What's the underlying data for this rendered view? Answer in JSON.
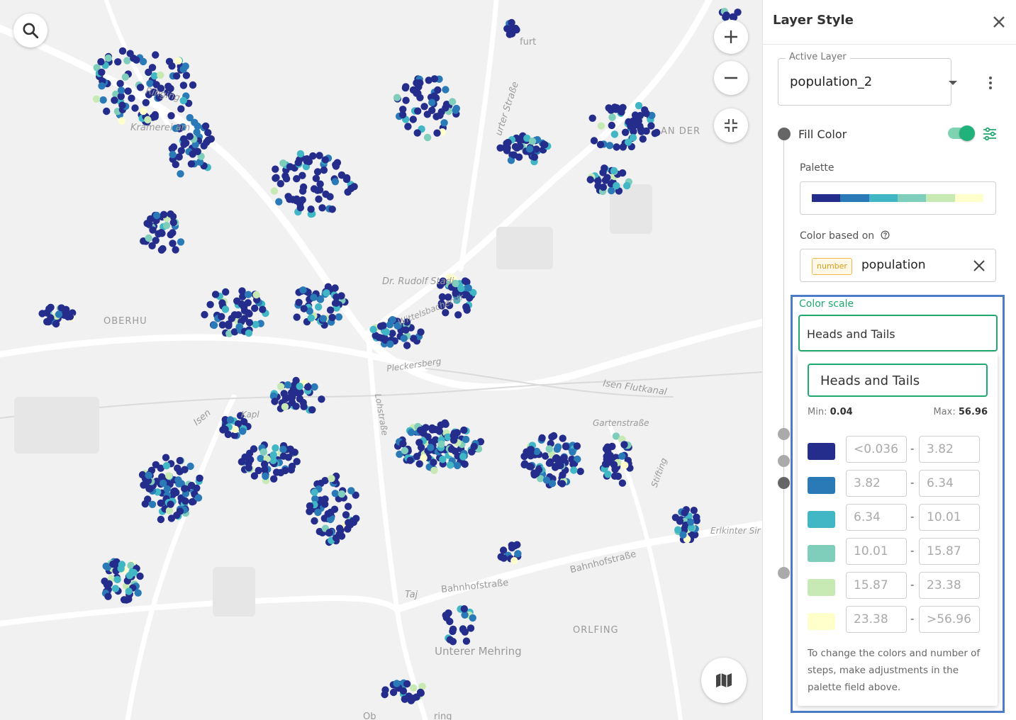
{
  "map": {
    "labels": [
      "Ringing",
      "Kramerei am",
      "OBERHU",
      "Dr. Rudolf Stadi",
      "Isen Flutkanal",
      "Isen",
      "Bahnhofstraße",
      "Bahnhofstraße",
      "Taj",
      "ORLFING",
      "Unterer Mehring",
      "AN DER",
      "furt",
      "urter Straße",
      "Gartenstraße",
      "Stifting",
      "Erlkinter Sir",
      "Wittelsbacherstr",
      "Kapl",
      "Lohstraße",
      "Pleckersberg",
      "Ob",
      "ring"
    ],
    "controls": {
      "search": "search-icon",
      "zoom_in": "plus-icon",
      "zoom_out": "minus-icon",
      "fit": "compress-icon",
      "basemap": "map-icon"
    },
    "point_colors": [
      "#252d8c",
      "#2a7ab8",
      "#41b6c4",
      "#7fcdbb",
      "#c7e9b4",
      "#ffffcc"
    ]
  },
  "panel": {
    "title": "Layer Style",
    "close_icon": "close-icon",
    "active_layer": {
      "label": "Active Layer",
      "value": "population_2"
    },
    "fill_color": {
      "label": "Fill Color",
      "enabled": true
    },
    "palette": {
      "label": "Palette",
      "colors": [
        "#252d8c",
        "#2a7ab8",
        "#41b6c4",
        "#7fcdbb",
        "#c7e9b4",
        "#ffffcc"
      ]
    },
    "color_based_on": {
      "label": "Color based on",
      "type_badge": "number",
      "value": "population"
    },
    "color_scale": {
      "label": "Color scale",
      "selected": "Heads and Tails",
      "dropdown_option": "Heads and Tails",
      "min_label": "Min:",
      "min_value": "0.04",
      "max_label": "Max:",
      "max_value": "56.96",
      "steps": [
        {
          "color": "#252d8c",
          "from": "<0.036",
          "to": "3.82"
        },
        {
          "color": "#2a7ab8",
          "from": "3.82",
          "to": "6.34"
        },
        {
          "color": "#41b6c4",
          "from": "6.34",
          "to": "10.01"
        },
        {
          "color": "#7fcdbb",
          "from": "10.01",
          "to": "15.87"
        },
        {
          "color": "#c7e9b4",
          "from": "15.87",
          "to": "23.38"
        },
        {
          "color": "#ffffcc",
          "from": "23.38",
          "to": ">56.96"
        }
      ],
      "separator": "-",
      "note": "To change the colors and number of steps, make adjustments in the palette field above."
    }
  }
}
